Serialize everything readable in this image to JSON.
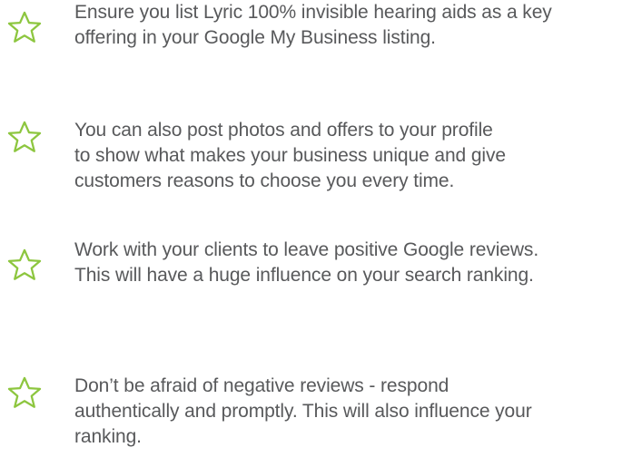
{
  "colors": {
    "text": "#58595b",
    "accent": "#8dc63f"
  },
  "tips": [
    {
      "icon": "star-icon",
      "lines": [
        "Ensure you list Lyric 100% invisible hearing aids as a key",
        "offering in your Google My Business listing."
      ]
    },
    {
      "icon": "star-icon",
      "lines": [
        "You can also post photos and offers to your profile",
        "to show what makes your business unique and give",
        "customers reasons to choose you every time."
      ]
    },
    {
      "icon": "star-icon",
      "lines": [
        "Work with your clients to leave positive Google reviews.",
        "This will have a huge influence on your search ranking."
      ]
    },
    {
      "icon": "star-icon",
      "lines": [
        "Don’t be afraid of negative reviews - respond",
        "authentically and promptly. This will also influence your",
        "ranking."
      ]
    }
  ]
}
